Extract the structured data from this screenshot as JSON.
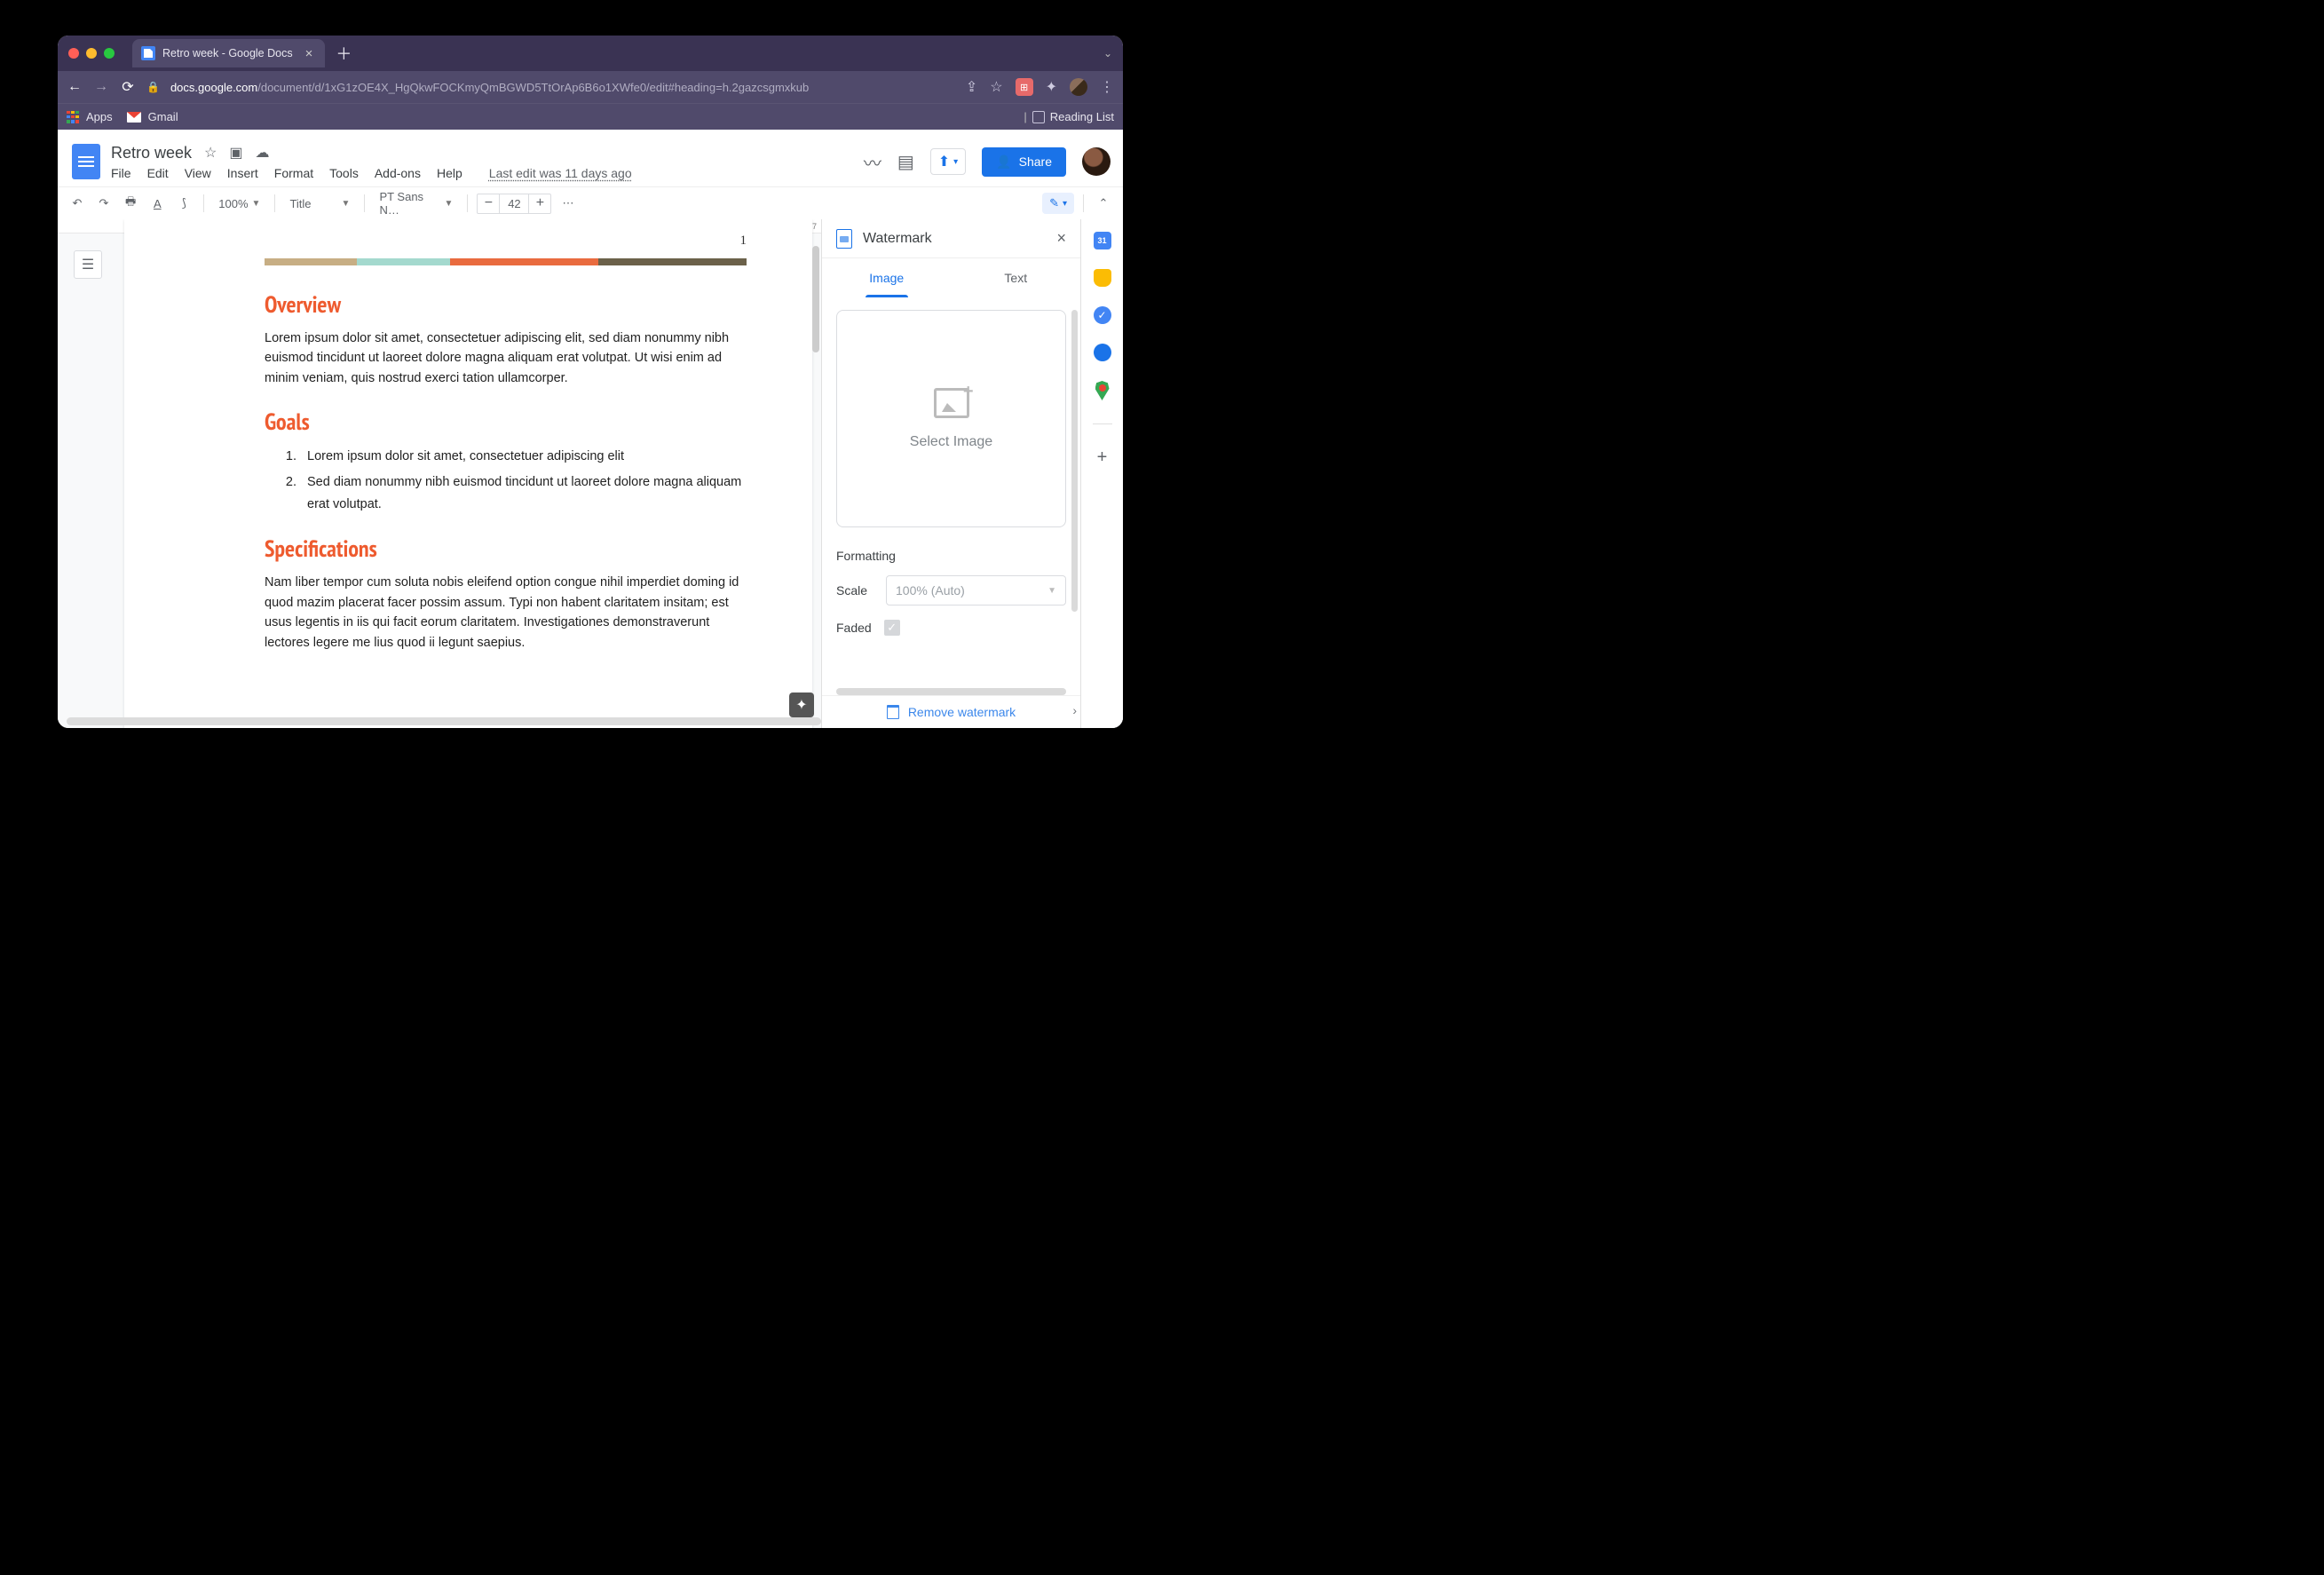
{
  "browser": {
    "tab_title": "Retro week - Google Docs",
    "url_host": "docs.google.com",
    "url_path": "/document/d/1xG1zOE4X_HgQkwFOCKmyQmBGWD5TtOrAp6B6o1XWfe0/edit#heading=h.2gazcsgmxkub",
    "bookmarks": {
      "apps": "Apps",
      "gmail": "Gmail",
      "reading_list": "Reading List"
    }
  },
  "docs": {
    "title": "Retro week",
    "menu": [
      "File",
      "Edit",
      "View",
      "Insert",
      "Format",
      "Tools",
      "Add-ons",
      "Help"
    ],
    "last_edit": "Last edit was 11 days ago",
    "share_label": "Share"
  },
  "toolbar": {
    "zoom": "100%",
    "style": "Title",
    "font": "PT Sans N…",
    "font_size": "42"
  },
  "document": {
    "page_number": "1",
    "sections": [
      {
        "heading": "Overview",
        "body": "Lorem ipsum dolor sit amet, consectetuer adipiscing elit, sed diam nonummy nibh euismod tincidunt ut laoreet dolore magna aliquam erat volutpat. Ut wisi enim ad minim veniam, quis nostrud exerci tation ullamcorper."
      },
      {
        "heading": "Goals",
        "list": [
          "Lorem ipsum dolor sit amet, consectetuer adipiscing elit",
          "Sed diam nonummy nibh euismod tincidunt ut laoreet dolore magna aliquam erat volutpat."
        ]
      },
      {
        "heading": "Specifications",
        "body": "Nam liber tempor cum soluta nobis eleifend option congue nihil imperdiet doming id quod mazim placerat facer possim assum. Typi non habent claritatem insitam; est usus legentis in iis qui facit eorum claritatem. Investigationes demonstraverunt lectores legere me lius quod ii legunt saepius."
      }
    ]
  },
  "panel": {
    "title": "Watermark",
    "tabs": {
      "image": "Image",
      "text": "Text"
    },
    "select_image": "Select Image",
    "formatting_label": "Formatting",
    "scale_label": "Scale",
    "scale_value": "100% (Auto)",
    "faded_label": "Faded",
    "remove_label": "Remove watermark"
  }
}
